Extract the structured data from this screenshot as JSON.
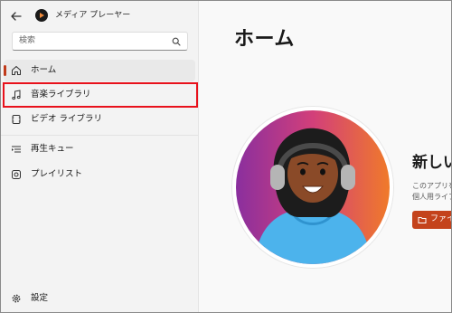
{
  "app": {
    "title": "メディア プレーヤー",
    "accent_color": "#c4431c"
  },
  "search": {
    "placeholder": "検索"
  },
  "sidebar": {
    "items": [
      {
        "label": "ホーム",
        "icon": "home-icon",
        "selected": true
      },
      {
        "label": "音楽ライブラリ",
        "icon": "music-note-icon",
        "highlighted": true
      },
      {
        "label": "ビデオ ライブラリ",
        "icon": "video-icon"
      },
      {
        "label": "再生キュー",
        "icon": "queue-icon"
      },
      {
        "label": "プレイリスト",
        "icon": "playlist-icon"
      }
    ],
    "settings_label": "設定"
  },
  "main": {
    "title": "ホーム",
    "welcome": {
      "heading": "新しい",
      "line1": "このアプリを",
      "line2": "個人用ライブ",
      "button_label": "ファイ"
    }
  },
  "annotation": {
    "highlight_color": "#e8111b"
  }
}
